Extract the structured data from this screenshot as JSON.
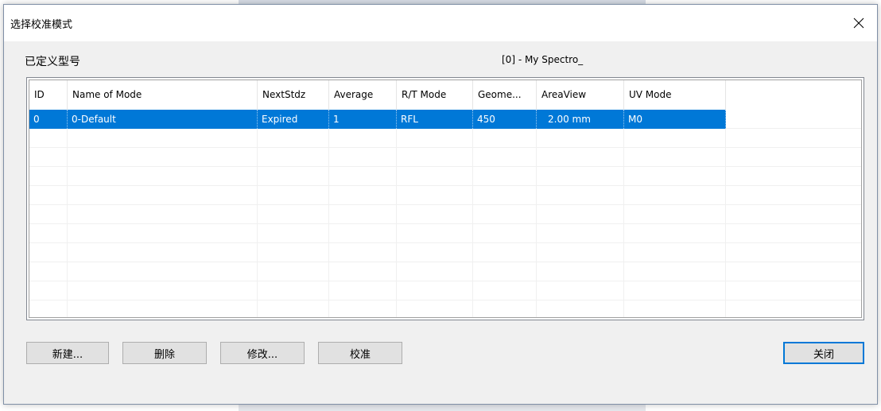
{
  "dialog": {
    "title": "选择校准模式",
    "section_label": "已定义型号",
    "model_label": "[0] - My Spectro_"
  },
  "table": {
    "columns": [
      "ID",
      "Name of Mode",
      "NextStdz",
      "Average",
      "R/T Mode",
      "Geome...",
      "AreaView",
      "UV Mode",
      ""
    ],
    "rows": [
      [
        "0",
        "0-Default",
        "Expired",
        "1",
        "RFL",
        "450",
        "2.00 mm",
        "M0"
      ]
    ]
  },
  "buttons": {
    "new": "新建...",
    "delete": "删除",
    "modify": "修改...",
    "calibrate": "校准",
    "close": "关闭"
  },
  "colors": {
    "selection": "#0078d7",
    "dialog_bg": "#f0f0f0",
    "button_bg": "#e1e1e1"
  },
  "icons": {
    "close": "close-icon"
  }
}
